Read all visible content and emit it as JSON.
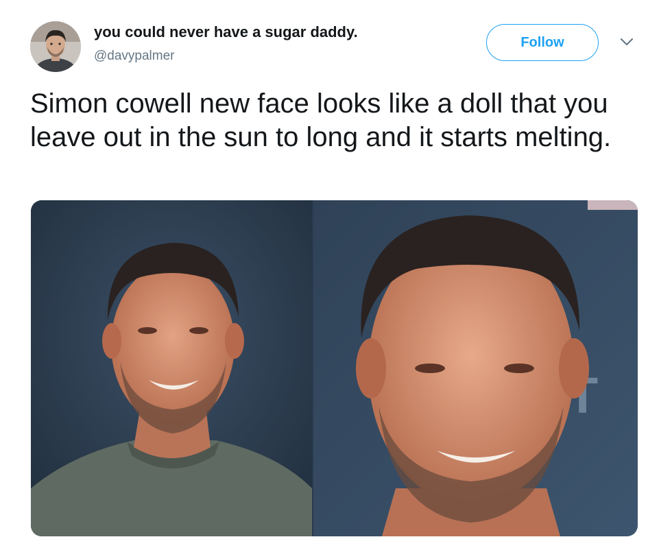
{
  "user": {
    "display_name": "you could never have a sugar daddy.",
    "handle": "@davypalmer"
  },
  "actions": {
    "follow_label": "Follow"
  },
  "tweet": {
    "text": "Simon cowell new face looks like a doll that you leave out in the sun to long and it starts melting."
  },
  "colors": {
    "accent": "#1da1f2",
    "text": "#14171a",
    "secondary_text": "#657786"
  },
  "icons": {
    "more": "chevron-down-icon"
  },
  "media": {
    "photo_right_backdrop_letter": "T"
  }
}
